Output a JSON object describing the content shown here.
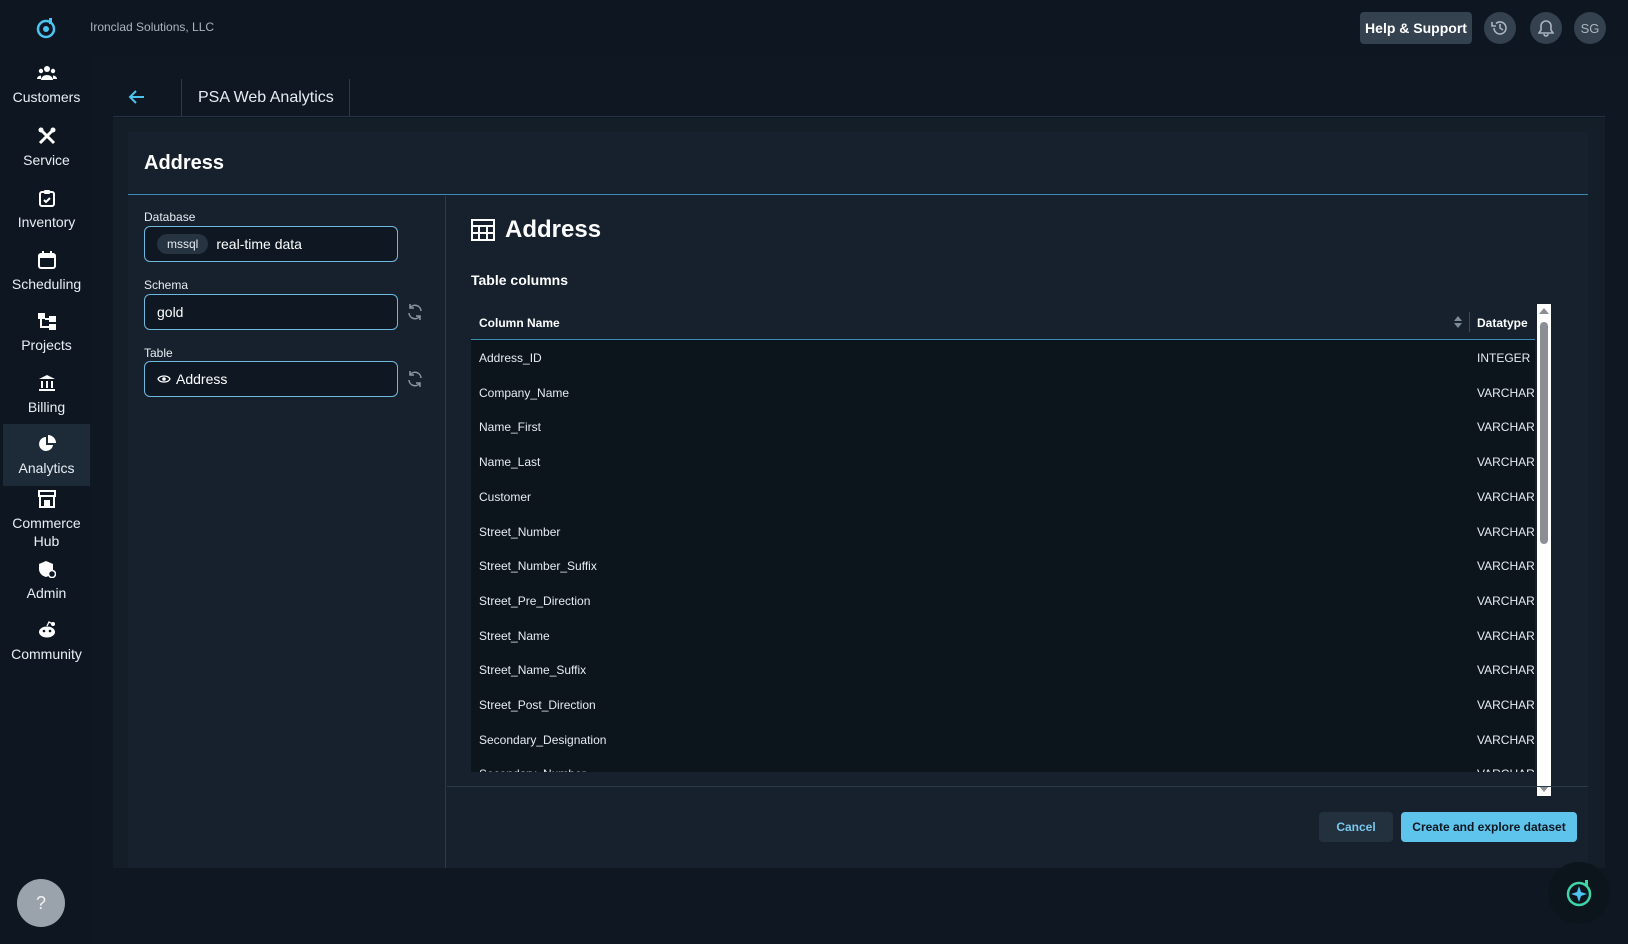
{
  "topbar": {
    "org_name": "Ironclad Solutions, LLC",
    "help_label": "Help & Support",
    "history_icon": "history-icon",
    "bell_icon": "bell-icon",
    "avatar_initials": "SG"
  },
  "sidebar": {
    "items": [
      {
        "label": "Customers",
        "icon": "customers-icon"
      },
      {
        "label": "Service",
        "icon": "tools-icon"
      },
      {
        "label": "Inventory",
        "icon": "clipboard-icon"
      },
      {
        "label": "Scheduling",
        "icon": "calendar-icon"
      },
      {
        "label": "Projects",
        "icon": "projects-icon"
      },
      {
        "label": "Billing",
        "icon": "bank-icon"
      },
      {
        "label": "Analytics",
        "icon": "pie-chart-icon",
        "active": true
      },
      {
        "label": "Commerce Hub",
        "icon": "store-icon"
      },
      {
        "label": "Admin",
        "icon": "admin-shield-icon"
      },
      {
        "label": "Community",
        "icon": "community-icon"
      }
    ],
    "help_fab_label": "?"
  },
  "breadcrumb": {
    "title": "PSA Web Analytics"
  },
  "card": {
    "title": "Address"
  },
  "form": {
    "database_label": "Database",
    "database_chip": "mssql",
    "database_value": "real-time data",
    "schema_label": "Schema",
    "schema_value": "gold",
    "table_label": "Table",
    "table_value": "Address"
  },
  "table_view": {
    "title": "Address",
    "columns_label": "Table columns",
    "headers": {
      "name": "Column Name",
      "type": "Datatype"
    },
    "rows": [
      {
        "name": "Address_ID",
        "type": "INTEGER"
      },
      {
        "name": "Company_Name",
        "type": "VARCHAR"
      },
      {
        "name": "Name_First",
        "type": "VARCHAR"
      },
      {
        "name": "Name_Last",
        "type": "VARCHAR"
      },
      {
        "name": "Customer",
        "type": "VARCHAR"
      },
      {
        "name": "Street_Number",
        "type": "VARCHAR"
      },
      {
        "name": "Street_Number_Suffix",
        "type": "VARCHAR"
      },
      {
        "name": "Street_Pre_Direction",
        "type": "VARCHAR"
      },
      {
        "name": "Street_Name",
        "type": "VARCHAR"
      },
      {
        "name": "Street_Name_Suffix",
        "type": "VARCHAR"
      },
      {
        "name": "Street_Post_Direction",
        "type": "VARCHAR"
      },
      {
        "name": "Secondary_Designation",
        "type": "VARCHAR"
      },
      {
        "name": "Secondary_Number",
        "type": "VARCHAR"
      }
    ]
  },
  "actions": {
    "cancel_label": "Cancel",
    "create_label": "Create and explore dataset"
  },
  "colors": {
    "accent": "#5fc4ec",
    "background": "#0f1822",
    "sidebar": "#0e1721",
    "row_border": "#3b8bb3"
  }
}
